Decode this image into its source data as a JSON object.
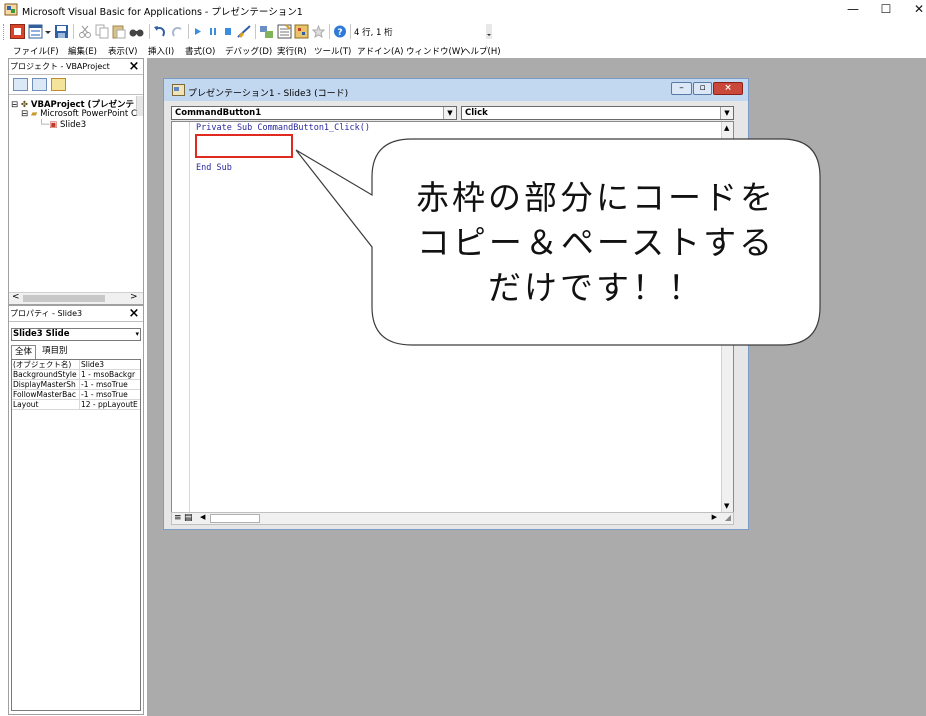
{
  "window": {
    "title": "Microsoft Visual Basic for Applications - プレゼンテーション1",
    "minimize": "—",
    "maximize": "☐",
    "close": "✕"
  },
  "toolbar": {
    "position_text": "4 行, 1 桁"
  },
  "menu": {
    "items": [
      "ファイル(F)",
      "編集(E)",
      "表示(V)",
      "挿入(I)",
      "書式(O)",
      "デバッグ(D)",
      "実行(R)",
      "ツール(T)",
      "アドイン(A)",
      "ウィンドウ(W)",
      "ヘルプ(H)"
    ]
  },
  "project_panel": {
    "title": "プロジェクト - VBAProject",
    "tree": [
      "VBAProject (プレゼンテ",
      "Microsoft PowerPoint C",
      "Slide3"
    ]
  },
  "properties_panel": {
    "title": "プロパティ - Slide3",
    "object_select": "Slide3 Slide",
    "tabs": [
      "全体",
      "項目別"
    ],
    "rows": [
      {
        "name": "(オブジェクト名)",
        "value": "Slide3"
      },
      {
        "name": "BackgroundStyle",
        "value": "1 - msoBackgr"
      },
      {
        "name": "DisplayMasterSh",
        "value": "-1 - msoTrue"
      },
      {
        "name": "FollowMasterBac",
        "value": "-1 - msoTrue"
      },
      {
        "name": "Layout",
        "value": "12 - ppLayoutE"
      }
    ]
  },
  "code_window": {
    "title": "プレゼンテーション1 - Slide3 (コード)",
    "object_combo": "CommandButton1",
    "proc_combo": "Click",
    "lines": [
      "Private Sub CommandButton1_Click()",
      "End Sub"
    ]
  },
  "callout": {
    "lines": [
      "赤枠の部分にコードを",
      "コピー＆ペーストする",
      "だけです！！"
    ]
  },
  "colors": {
    "workspace": "#ababab",
    "highlight_box": "#e02a1f",
    "code_text": "#2a2aa0"
  }
}
